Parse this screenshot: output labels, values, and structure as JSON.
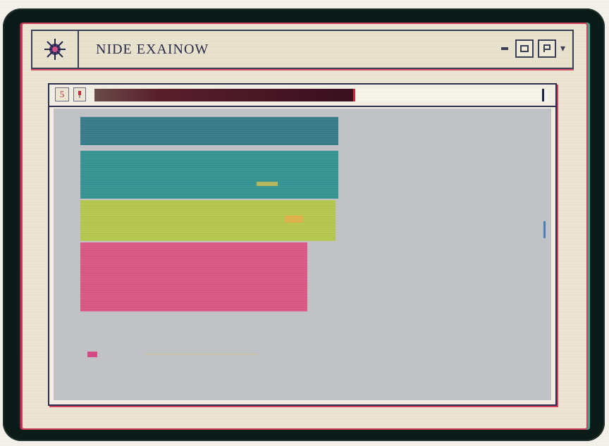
{
  "window": {
    "title": "NIDE EXAINOW",
    "controls": [
      {
        "name": "minimize",
        "icon": "minimize-icon"
      },
      {
        "name": "restore",
        "icon": "restore-icon"
      },
      {
        "name": "maximize",
        "icon": "maximize-icon"
      }
    ]
  },
  "toolbar": {
    "tool_1_icon": "tool-icon",
    "tool_1_label": "5",
    "progress_fraction": 0.57
  },
  "content": {
    "bars": [
      {
        "color": "#2e7585"
      },
      {
        "color": "#2b8f8d"
      },
      {
        "color": "#b2c545"
      },
      {
        "color": "#d9507e"
      }
    ]
  },
  "colors": {
    "frame": "#0b1b17",
    "window_bg": "#ebe4d2",
    "accent_red": "#cf3e5c",
    "accent_teal": "#3fa58c",
    "content_bg": "#c2c4c7"
  }
}
